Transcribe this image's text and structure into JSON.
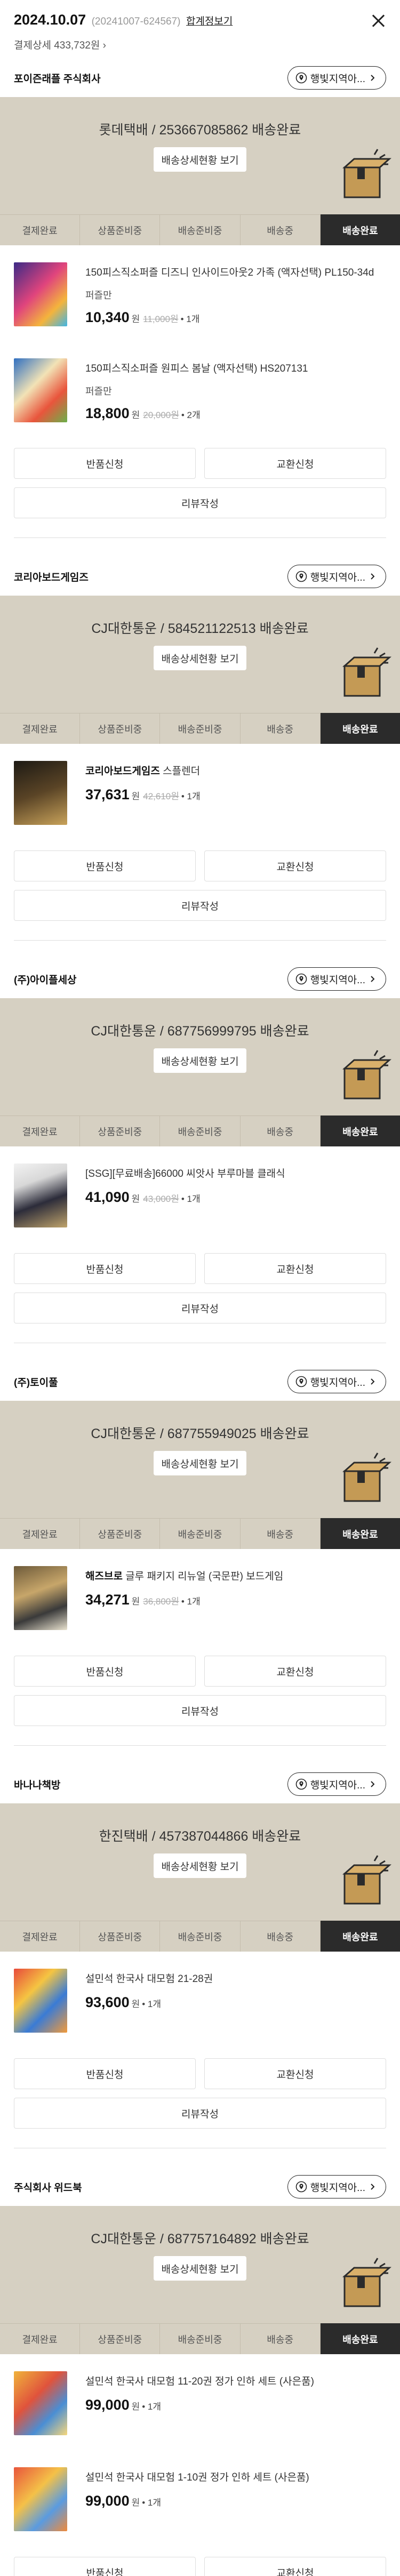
{
  "header": {
    "date": "2024.10.07",
    "order_no": "(20241007-624567)",
    "merge_view": "합계정보기",
    "summary": "결제상세 433,732원 ›"
  },
  "contact_label": "행빛지역아...",
  "detail_label": "배송상세현황 보기",
  "step_labels": [
    "결제완료",
    "상품준비중",
    "배송준비중",
    "배송중",
    "배송완료"
  ],
  "actions": {
    "return": "반품신청",
    "exchange": "교환신청",
    "review": "리뷰작성"
  },
  "sellers": [
    {
      "name": "포이즌래플 주식회사",
      "shipment": "롯데택배 / 253667085862 배송완료",
      "products": [
        {
          "name": "150피스직소퍼즐 디즈니 인사이드아웃2 가족 (액자선택) PL150-34d",
          "status": "퍼즐만",
          "price": "10,340",
          "won": "원",
          "original": "11,000원",
          "qty": "• 1개"
        },
        {
          "name": "150피스직소퍼즐 원피스 봄날 (액자선택) HS207131",
          "status": "퍼즐만",
          "price": "18,800",
          "won": "원",
          "original": "20,000원",
          "qty": "• 2개"
        }
      ]
    },
    {
      "name": "코리아보드게임즈",
      "shipment": "CJ대한통운 / 584521122513 배송완료",
      "products": [
        {
          "brand": "코리아보드게임즈",
          "name": "스플렌더",
          "price": "37,631",
          "won": "원",
          "original": "42,610원",
          "qty": "• 1개"
        }
      ]
    },
    {
      "name": "(주)아이플세상",
      "shipment": "CJ대한통운 / 687756999795 배송완료",
      "products": [
        {
          "name": "[SSG][무료배송]66000 씨앗사 부루마블 클래식",
          "price": "41,090",
          "won": "원",
          "original": "43,000원",
          "qty": "• 1개"
        }
      ]
    },
    {
      "name": "(주)토이풀",
      "shipment": "CJ대한통운 / 687755949025 배송완료",
      "products": [
        {
          "brand": "해즈브로",
          "name": "글루 패키지 리뉴얼 (국문판) 보드게임",
          "price": "34,271",
          "won": "원",
          "original": "36,800원",
          "qty": "• 1개"
        }
      ]
    },
    {
      "name": "바나나책방",
      "shipment": "한진택배 / 457387044866 배송완료",
      "products": [
        {
          "name": "설민석 한국사 대모험 21-28권",
          "price": "93,600",
          "won": "원",
          "qty": "• 1개"
        }
      ]
    },
    {
      "name": "주식회사 위드북",
      "shipment": "CJ대한통운 / 687757164892 배송완료",
      "products": [
        {
          "name": "설민석 한국사 대모험 11-20권 정가 인하 세트 (사은품)",
          "price": "99,000",
          "won": "원",
          "qty": "• 1개"
        },
        {
          "name": "설민석 한국사 대모험 1-10권 정가 인하 세트 (사은품)",
          "price": "99,000",
          "won": "원",
          "qty": "• 1개"
        }
      ]
    }
  ],
  "colors": {
    "hero_bg": "#d6d0c2",
    "active_step": "#2b2b2b"
  }
}
